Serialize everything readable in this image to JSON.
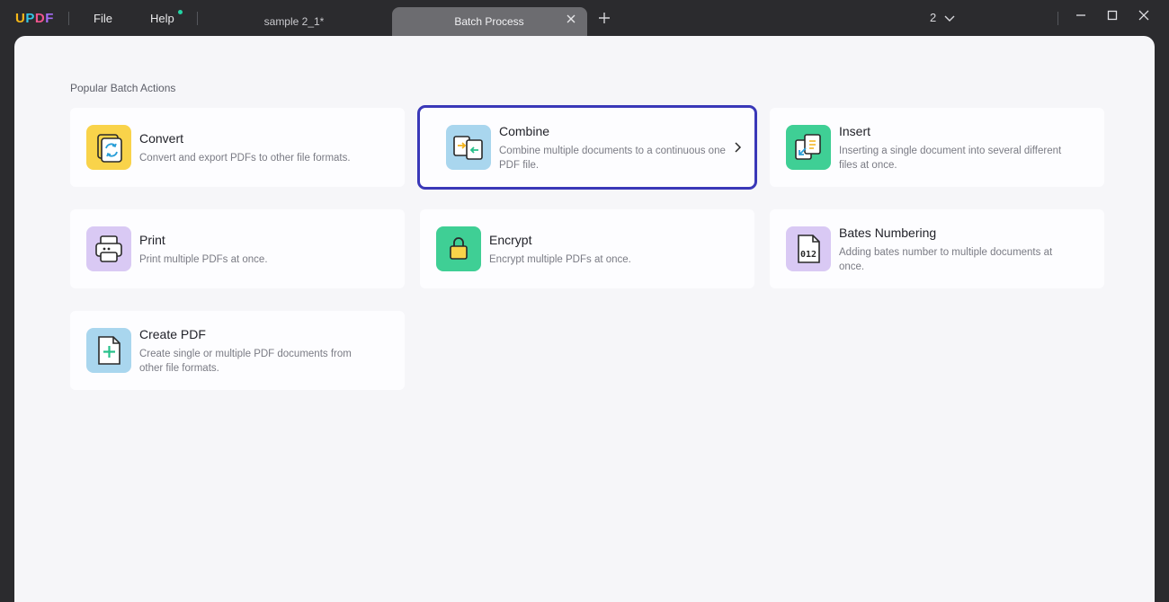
{
  "app": {
    "logo": {
      "u": "U",
      "p": "P",
      "d": "D",
      "f": "F"
    },
    "menu": {
      "file": "File",
      "help": "Help"
    },
    "tabs": [
      {
        "label": "sample 2_1*",
        "active": false
      },
      {
        "label": "Batch Process",
        "active": true
      }
    ],
    "page_count": "2",
    "icons": {
      "tab_close": "close-icon",
      "tab_add": "plus-icon",
      "minimize": "minimize-icon",
      "maximize": "maximize-icon",
      "close": "close-icon",
      "dropdown": "chevron-down-icon"
    },
    "colors": {
      "accent_highlight": "#3a38b8",
      "help_dot": "#23d3a4"
    }
  },
  "batch": {
    "section_title": "Popular Batch Actions",
    "cards": [
      {
        "title": "Convert",
        "desc": "Convert and export PDFs to other file formats.",
        "icon": "convert-icon",
        "color": "#f9d34a"
      },
      {
        "title": "Combine",
        "desc": "Combine multiple documents to a continuous one PDF file.",
        "icon": "combine-icon",
        "color": "#a9d6ee"
      },
      {
        "title": "Insert",
        "desc": "Inserting a single document into several different files at once.",
        "icon": "insert-icon",
        "color": "#3fcf95"
      },
      {
        "title": "Print",
        "desc": "Print multiple PDFs at once.",
        "icon": "print-icon",
        "color": "#d9c9f4"
      },
      {
        "title": "Encrypt",
        "desc": "Encrypt multiple PDFs at once.",
        "icon": "lock-icon",
        "color": "#3fcf95"
      },
      {
        "title": "Bates Numbering",
        "desc": "Adding bates number to multiple documents at once.",
        "icon": "bates-number-icon",
        "color": "#d9c9f4",
        "number_text": "012"
      },
      {
        "title": "Create PDF",
        "desc": "Create single or multiple PDF documents from other file formats.",
        "icon": "create-pdf-icon",
        "color": "#a9d6ee"
      }
    ]
  }
}
